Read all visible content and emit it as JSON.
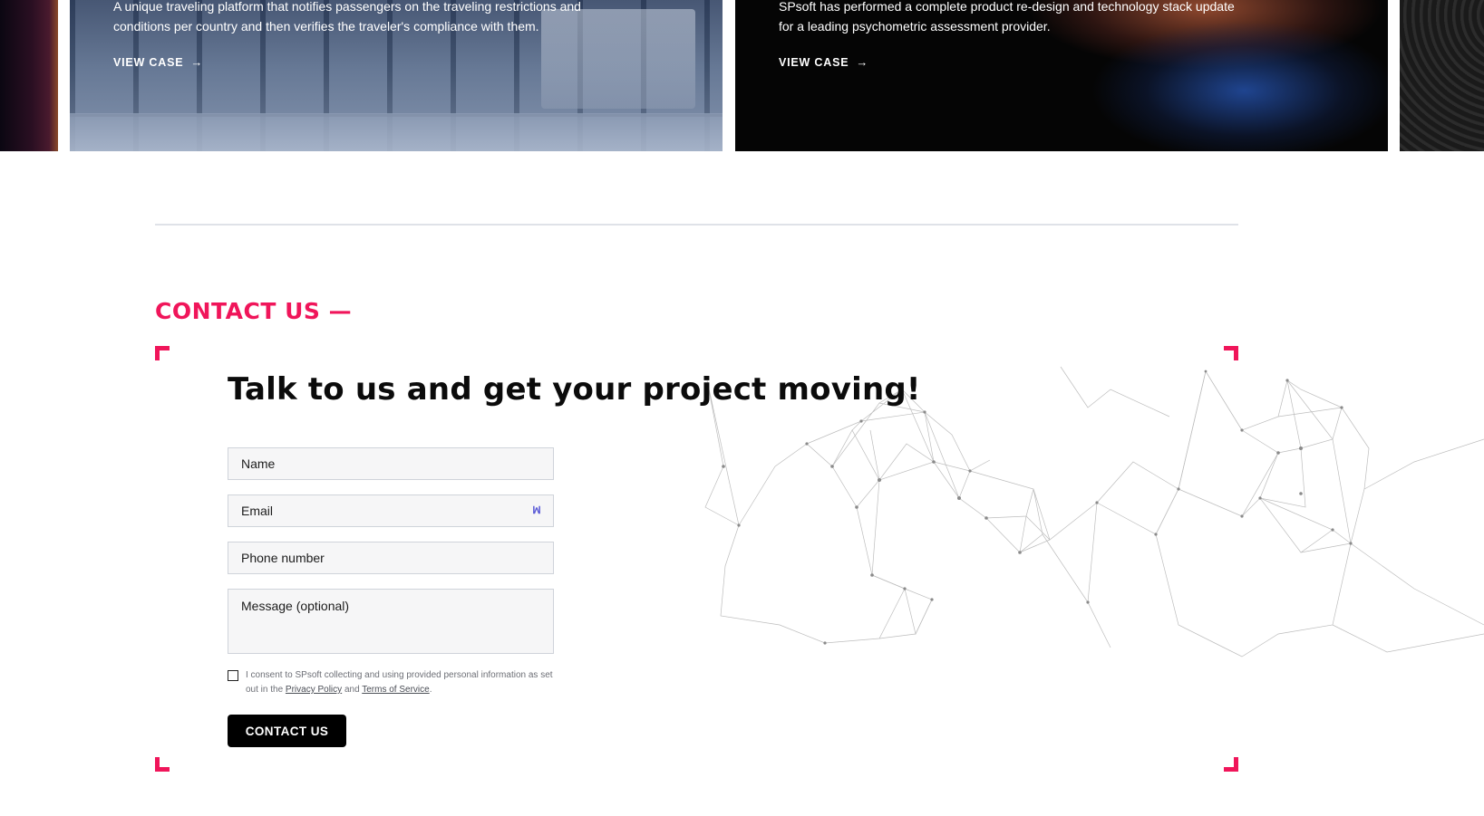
{
  "cases": [
    {
      "description": "A unique traveling platform that notifies passengers on the traveling restrictions and conditions per country and then verifies the traveler's compliance with them.",
      "link_label": "VIEW CASE",
      "arrow": "→"
    },
    {
      "description": "SPsoft has performed a complete product re-design and technology stack update for a leading psychometric assessment provider.",
      "link_label": "VIEW CASE",
      "arrow": "→"
    }
  ],
  "contact": {
    "section_label": "CONTACT US —",
    "headline": "Talk to us and get your project moving!",
    "fields": {
      "name": "Name",
      "email": "Email",
      "phone": "Phone number",
      "message": "Message (optional)"
    },
    "email_icon_glyph": "ꟽ",
    "consent": {
      "text_before": "I consent to SPsoft collecting and using provided personal information as set out in the ",
      "privacy_link": "Privacy Policy",
      "and": " and ",
      "terms_link": "Terms of Service",
      "period": "."
    },
    "submit_label": "CONTACT US"
  },
  "colors": {
    "accent": "#f0155a",
    "button_bg": "#000000",
    "field_bg": "#f6f6f7",
    "divider": "#dfe2e8"
  },
  "icons": {
    "arrow": "arrow-right-icon",
    "email_autofill": "email-autofill-icon",
    "corner": "corner-bracket-icon",
    "network": "network-mesh-illustration"
  }
}
